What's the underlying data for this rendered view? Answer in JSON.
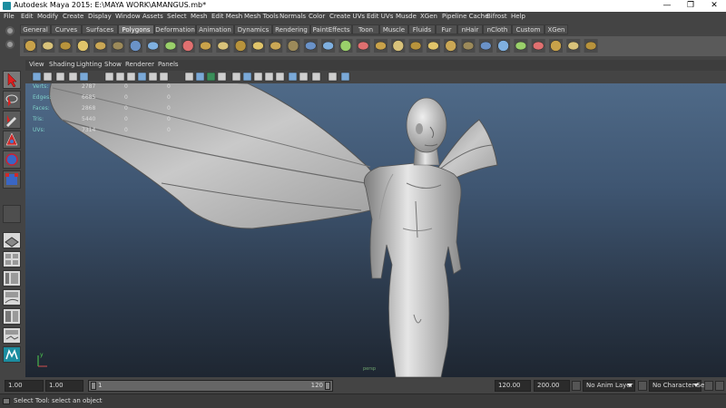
{
  "window": {
    "title": "Autodesk Maya 2015: E:\\MAYA WORK\\AMANGUS.mb*",
    "controls": {
      "minimize": "—",
      "maximize": "❐",
      "close": "✕"
    }
  },
  "menubar": {
    "items": [
      "File",
      "Edit",
      "Modify",
      "Create",
      "Display",
      "Window",
      "Assets",
      "Select",
      "Mesh",
      "Edit Mesh",
      "Mesh Tools",
      "Normals",
      "Color",
      "Create UVs",
      "Edit UVs",
      "Musde",
      "XGen",
      "Pipeline Cache",
      "Bifrost",
      "Help"
    ]
  },
  "shelf": {
    "tabs": [
      "General",
      "Curves",
      "Surfaces",
      "Polygons",
      "Deformation",
      "Animation",
      "Dynamics",
      "Rendering",
      "PaintEffects",
      "Toon",
      "Muscle",
      "Fluids",
      "Fur",
      "nHair",
      "nCloth",
      "Custom",
      "XGen"
    ],
    "active_tab": "Polygons",
    "icons": [
      "poly-sphere-icon",
      "poly-cube-icon",
      "poly-cylinder-icon",
      "poly-cone-icon",
      "poly-plane-icon",
      "poly-torus-icon",
      "poly-pyramid-icon",
      "poly-prism-icon",
      "poly-pipe-icon",
      "poly-helix-icon",
      "combine-icon",
      "separate-icon",
      "extract-icon",
      "booleans-icon",
      "smooth-icon",
      "average-vertices-icon",
      "bevel-icon",
      "bridge-icon",
      "extrude-icon",
      "append-icon",
      "split-icon",
      "insert-edge-loop-icon",
      "offset-edge-loop-icon",
      "merge-icon",
      "wedge-icon",
      "poke-icon",
      "checker-uv-icon",
      "planar-mapping-icon",
      "cylindrical-mapping-icon",
      "spherical-mapping-icon",
      "automatic-mapping-icon",
      "uv-editor-icon",
      "transfer-attributes-icon"
    ]
  },
  "panel": {
    "menus": [
      "View",
      "Shading",
      "Lighting",
      "Show",
      "Renderer",
      "Panels"
    ]
  },
  "hud": {
    "rows": [
      {
        "label": "Verts:",
        "v1": "2787",
        "v2": "0",
        "v3": "0"
      },
      {
        "label": "Edges:",
        "v1": "6685",
        "v2": "0",
        "v3": "0"
      },
      {
        "label": "Faces:",
        "v1": "2868",
        "v2": "0",
        "v3": "0"
      },
      {
        "label": "Tris:",
        "v1": "5440",
        "v2": "0",
        "v3": "0"
      },
      {
        "label": "UVs:",
        "v1": "7314",
        "v2": "0",
        "v3": "0"
      }
    ],
    "camera": "persp"
  },
  "timerange": {
    "start": "1.00",
    "playback_start": "1.00",
    "slider_start": "1",
    "slider_end": "120",
    "playback_end": "120.00",
    "end": "200.00",
    "anim_layer": "No Anim Layer",
    "character_set": "No Character Set"
  },
  "status": {
    "message": "Select Tool: select an object"
  },
  "colors": {
    "viewport_top": "#4f6a88",
    "viewport_bottom": "#1e2631",
    "hud_label": "#7fd0c8"
  }
}
